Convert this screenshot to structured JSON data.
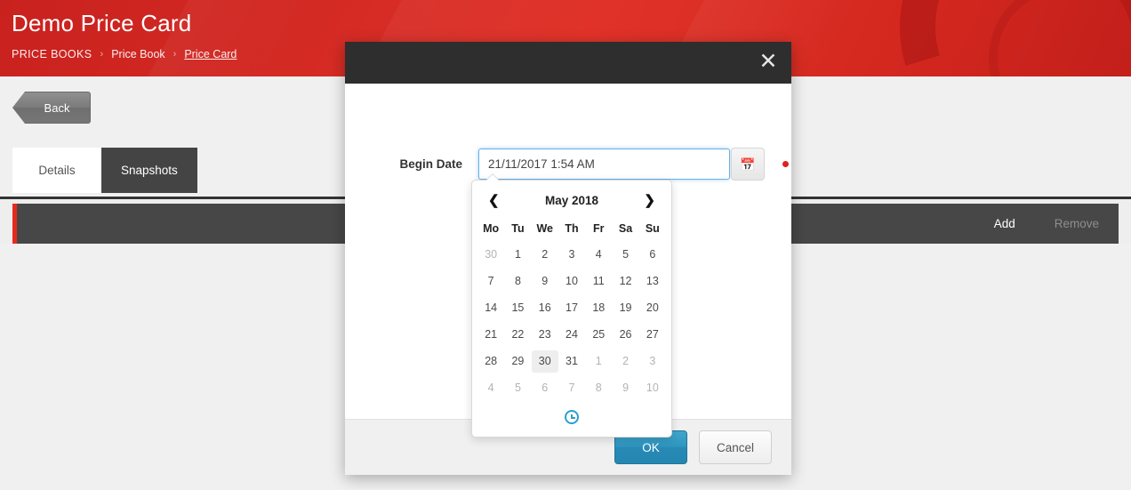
{
  "header": {
    "title": "Demo Price Card",
    "breadcrumb": [
      {
        "label": "PRICE BOOKS",
        "current": false
      },
      {
        "label": "Price Book",
        "current": false
      },
      {
        "label": "Price Card",
        "current": true
      }
    ],
    "separator": "›",
    "brand_color": "#d42a24"
  },
  "back_button": {
    "label": "Back"
  },
  "tabs": [
    {
      "label": "Details",
      "state": "light"
    },
    {
      "label": "Snapshots",
      "state": "dark"
    }
  ],
  "toolbar": {
    "accent_color": "#e8291e",
    "add_label": "Add",
    "remove_label": "Remove"
  },
  "modal": {
    "close_icon": "close-icon",
    "field": {
      "label": "Begin Date",
      "value": "21/11/2017 1:54 AM",
      "placeholder": "",
      "calendar_icon": "calendar-icon",
      "required_marker_color": "#e02020"
    },
    "datepicker": {
      "prev_icon": "❮",
      "next_icon": "❯",
      "title": "May 2018",
      "weekdays": [
        "Mo",
        "Tu",
        "We",
        "Th",
        "Fr",
        "Sa",
        "Su"
      ],
      "weeks": [
        [
          {
            "d": "30",
            "muted": true,
            "hovered": false
          },
          {
            "d": "1",
            "muted": false,
            "hovered": false
          },
          {
            "d": "2",
            "muted": false,
            "hovered": false
          },
          {
            "d": "3",
            "muted": false,
            "hovered": false
          },
          {
            "d": "4",
            "muted": false,
            "hovered": false
          },
          {
            "d": "5",
            "muted": false,
            "hovered": false
          },
          {
            "d": "6",
            "muted": false,
            "hovered": false
          }
        ],
        [
          {
            "d": "7",
            "muted": false,
            "hovered": false
          },
          {
            "d": "8",
            "muted": false,
            "hovered": false
          },
          {
            "d": "9",
            "muted": false,
            "hovered": false
          },
          {
            "d": "10",
            "muted": false,
            "hovered": false
          },
          {
            "d": "11",
            "muted": false,
            "hovered": false
          },
          {
            "d": "12",
            "muted": false,
            "hovered": false
          },
          {
            "d": "13",
            "muted": false,
            "hovered": false
          }
        ],
        [
          {
            "d": "14",
            "muted": false,
            "hovered": false
          },
          {
            "d": "15",
            "muted": false,
            "hovered": false
          },
          {
            "d": "16",
            "muted": false,
            "hovered": false
          },
          {
            "d": "17",
            "muted": false,
            "hovered": false
          },
          {
            "d": "18",
            "muted": false,
            "hovered": false
          },
          {
            "d": "19",
            "muted": false,
            "hovered": false
          },
          {
            "d": "20",
            "muted": false,
            "hovered": false
          }
        ],
        [
          {
            "d": "21",
            "muted": false,
            "hovered": false
          },
          {
            "d": "22",
            "muted": false,
            "hovered": false
          },
          {
            "d": "23",
            "muted": false,
            "hovered": false
          },
          {
            "d": "24",
            "muted": false,
            "hovered": false
          },
          {
            "d": "25",
            "muted": false,
            "hovered": false
          },
          {
            "d": "26",
            "muted": false,
            "hovered": false
          },
          {
            "d": "27",
            "muted": false,
            "hovered": false
          }
        ],
        [
          {
            "d": "28",
            "muted": false,
            "hovered": false
          },
          {
            "d": "29",
            "muted": false,
            "hovered": false
          },
          {
            "d": "30",
            "muted": false,
            "hovered": true
          },
          {
            "d": "31",
            "muted": false,
            "hovered": false
          },
          {
            "d": "1",
            "muted": true,
            "hovered": false
          },
          {
            "d": "2",
            "muted": true,
            "hovered": false
          },
          {
            "d": "3",
            "muted": true,
            "hovered": false
          }
        ],
        [
          {
            "d": "4",
            "muted": true,
            "hovered": false
          },
          {
            "d": "5",
            "muted": true,
            "hovered": false
          },
          {
            "d": "6",
            "muted": true,
            "hovered": false
          },
          {
            "d": "7",
            "muted": true,
            "hovered": false
          },
          {
            "d": "8",
            "muted": true,
            "hovered": false
          },
          {
            "d": "9",
            "muted": true,
            "hovered": false
          },
          {
            "d": "10",
            "muted": true,
            "hovered": false
          }
        ]
      ],
      "time_toggle_icon": "clock-icon",
      "accent_color": "#2a9fd0"
    },
    "footer": {
      "ok_label": "OK",
      "cancel_label": "Cancel"
    }
  }
}
